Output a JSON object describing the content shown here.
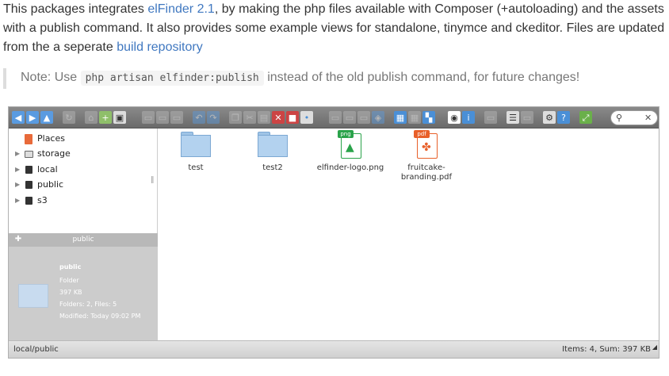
{
  "intro": {
    "p1": "This packages integrates ",
    "link1": "elFinder 2.1",
    "p2": ", by making the php files available with Composer (+autoloading) and the assets with a publish command. It also provides some example views for standalone, tinymce and ckeditor. Files are updated from the a seperate ",
    "link2": "build repository"
  },
  "note": {
    "prefix": "Note: Use ",
    "code": "php artisan elfinder:publish",
    "suffix": " instead of the old publish command, for future changes!"
  },
  "elfinder": {
    "accent": "#4a8fd6",
    "toolbar_icons": [
      "back-icon",
      "forward-icon",
      "up-icon",
      "reload-icon",
      "home-icon",
      "netmount-icon",
      "save-icon",
      "open-icon",
      "download-icon",
      "getfile-icon",
      "undo-icon",
      "redo-icon",
      "copy-icon",
      "cut-icon",
      "paste-icon",
      "delete-icon",
      "empty-icon",
      "hide-icon",
      "duplicate-icon",
      "rename-icon",
      "edit-icon",
      "resize-icon",
      "extract-icon",
      "archive-icon",
      "view-icons-icon",
      "view-list-icon",
      "select-all-icon",
      "preview-icon",
      "info-icon",
      "sort-icon",
      "columns-icon",
      "preferences-icon",
      "help-icon",
      "fullscreen-icon",
      "search-icon"
    ],
    "search": {
      "icon": "search-icon",
      "clear_icon": "close-icon"
    },
    "tree": [
      {
        "label": "Places",
        "icon": "places-icon",
        "expand": false
      },
      {
        "label": "storage",
        "icon": "drive-icon",
        "expand": true
      },
      {
        "label": "local",
        "icon": "network-drive-icon",
        "expand": true
      },
      {
        "label": "public",
        "icon": "network-drive-icon",
        "expand": true
      },
      {
        "label": "s3",
        "icon": "network-drive-icon",
        "expand": true
      }
    ],
    "info_panel": {
      "header": "public",
      "name": "public",
      "kind": "Folder",
      "size": "397 KB",
      "contains": "Folders: 2, Files: 5",
      "modified": "Modified: Today 09:02 PM"
    },
    "files": [
      {
        "name": "test",
        "type": "folder"
      },
      {
        "name": "test2",
        "type": "folder"
      },
      {
        "name": "elfinder-logo.png",
        "type": "png",
        "badge": "png",
        "color": "#2aa34a"
      },
      {
        "name": "fruitcake-branding.pdf",
        "type": "pdf",
        "badge": "pdf",
        "color": "#e8602a"
      }
    ],
    "status": {
      "path": "local/public",
      "summary": "Items: 4, Sum: 397 KB"
    }
  }
}
